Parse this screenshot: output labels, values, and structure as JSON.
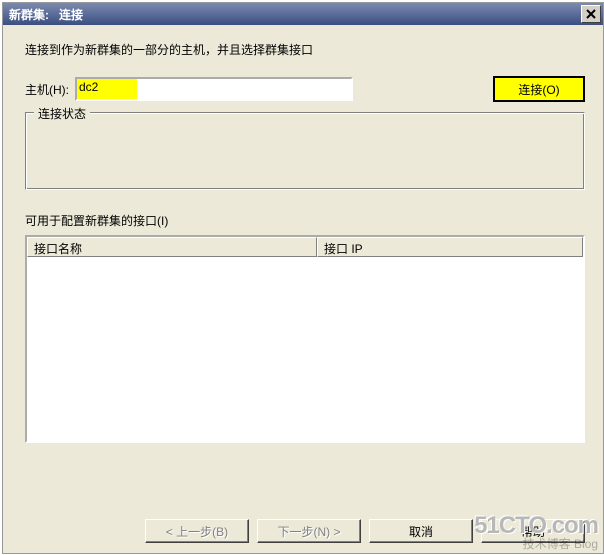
{
  "titlebar": {
    "title": "新群集:   连接"
  },
  "instruction": "连接到作为新群集的一部分的主机，并且选择群集接口",
  "host": {
    "label": "主机(H):",
    "value": "dc2"
  },
  "buttons": {
    "connect": "连接(O)",
    "back": "< 上一步(B)",
    "next": "下一步(N) >",
    "cancel": "取消",
    "help": "帮助"
  },
  "groupbox": {
    "status_legend": "连接状态"
  },
  "available": {
    "label": "可用于配置新群集的接口(I)"
  },
  "table": {
    "headers": {
      "name": "接口名称",
      "ip": "接口 IP"
    }
  },
  "watermark": {
    "line1": "51CTO.com",
    "line2": "技术博客  Blog"
  }
}
